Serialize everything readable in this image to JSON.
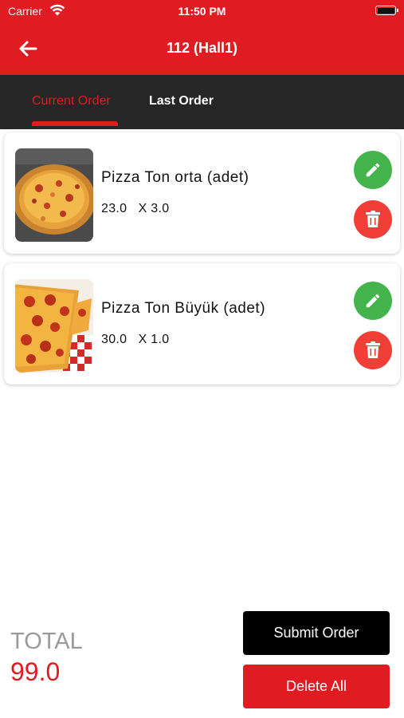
{
  "status_bar": {
    "carrier": "Carrier",
    "time": "11:50 PM",
    "wifi_icon": "wifi-icon",
    "battery_icon": "battery-icon"
  },
  "header": {
    "back_icon": "arrow-left-icon",
    "title": "112 (Hall1)",
    "color": "#e01b22"
  },
  "tabs": [
    {
      "label": "Current Order",
      "active": true
    },
    {
      "label": "Last Order",
      "active": false
    }
  ],
  "order_items": [
    {
      "name": "Pizza Ton orta (adet)",
      "price": "23.0",
      "quantity": "X 3.0",
      "image": "pizza-photo",
      "edit_icon": "pencil-icon",
      "delete_icon": "trash-icon"
    },
    {
      "name": "Pizza Ton Büyük (adet)",
      "price": "30.0",
      "quantity": "X 1.0",
      "image": "pepperoni-pizza-photo",
      "edit_icon": "pencil-icon",
      "delete_icon": "trash-icon"
    }
  ],
  "footer": {
    "total_label": "TOTAL",
    "total_value": "99.0",
    "submit_label": "Submit Order",
    "delete_all_label": "Delete All"
  },
  "colors": {
    "accent": "#e01b22",
    "tab_bar": "#262626",
    "edit": "#43b44c",
    "delete": "#f13f37"
  }
}
